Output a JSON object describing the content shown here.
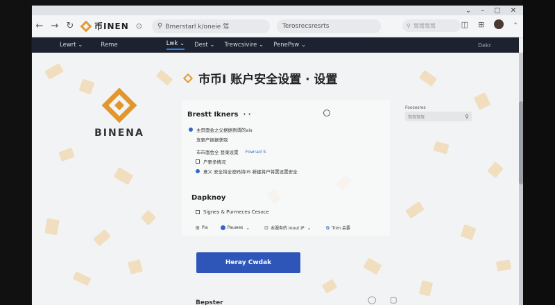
{
  "browser": {
    "tab_logo_text": "币INEN",
    "tab_extra": "⊙",
    "url": "Bmerstarl k/oneie 驾",
    "tab_title": "Terosrecsresrts",
    "search_placeholder": "驾驾驾驾"
  },
  "nav": {
    "items": [
      "Lewrt ⌄",
      "Reme",
      "Lwk ⌄",
      "Dest ⌄",
      "Trewcsivire ⌄",
      "PenePsw ⌄"
    ],
    "right": "Dekr"
  },
  "page": {
    "heading": "市币I 账户安全设置 · 设置",
    "brand_word": "BINENA"
  },
  "section1": {
    "title": "Brestt Ikners",
    "options": [
      "主页面会之父据据例谓的ais",
      "支更产据据获取",
      "市市面会全 登录设置",
      "户更多情况",
      "意义 安全将全密码将IIS 新建将户将置设置安全"
    ],
    "link": "Fowrad S"
  },
  "sidebox": {
    "label": "Foosesres",
    "placeholder": "驾驾驾驾"
  },
  "section2": {
    "title": "Dapknoy",
    "checkbox_label": "Signes & Purmeces Cesoce",
    "row": {
      "item1": "Pia",
      "item2": "Pauwes",
      "item3": "本服务的 Inout IP",
      "item4": "Trim 会要"
    }
  },
  "primary_button": "Heray Cwdak",
  "footer_title": "Bepster",
  "colors": {
    "accent": "#e69a2e",
    "nav_bg": "#1c2230",
    "primary": "#2d56b8"
  }
}
